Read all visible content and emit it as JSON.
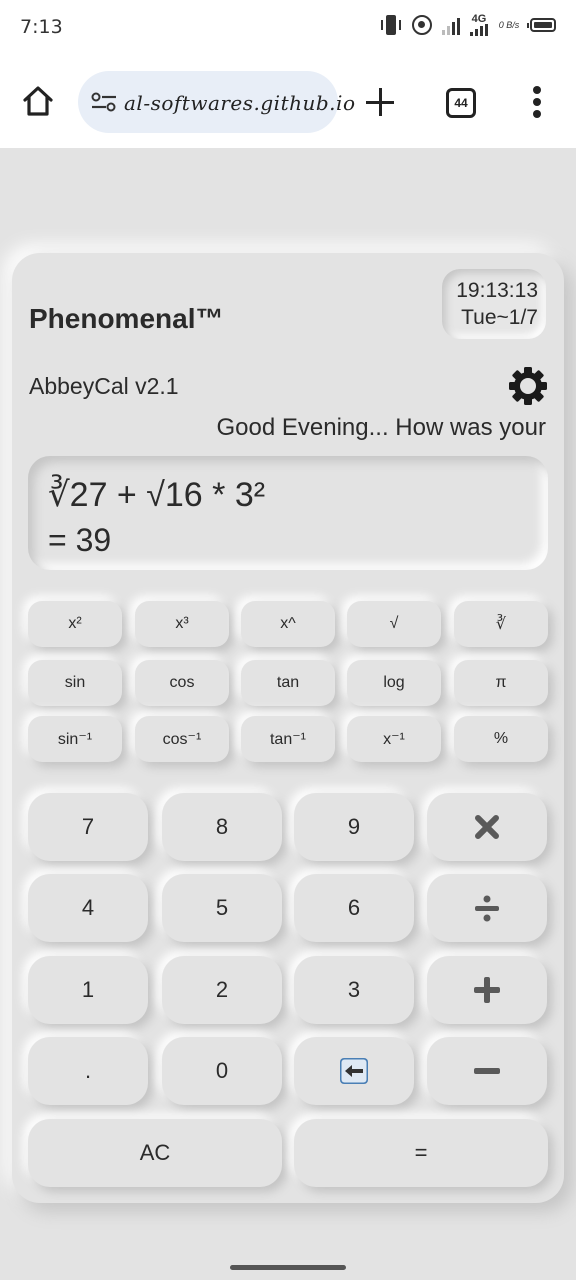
{
  "status_bar": {
    "time": "7:13",
    "network": "4G",
    "speed": "0 B/s"
  },
  "browser": {
    "url": "al-softwares.github.io",
    "tab_count": "44"
  },
  "calculator": {
    "brand": "Phenomenal™",
    "clock_time": "19:13:13",
    "clock_date": "Tue~1/7",
    "version": "AbbeyCal v2.1",
    "greeting": "Good Evening... How was your",
    "expression": "∛27 + √16 * 3²",
    "result": "= 39",
    "function_rows": [
      [
        "x²",
        "x³",
        "x^",
        "√",
        "∛"
      ],
      [
        "sin",
        "cos",
        "tan",
        "log",
        "π"
      ],
      [
        "sin⁻¹",
        "cos⁻¹",
        "tan⁻¹",
        "x⁻¹",
        "%"
      ]
    ],
    "number_rows": [
      [
        "7",
        "8",
        "9"
      ],
      [
        "4",
        "5",
        "6"
      ],
      [
        "1",
        "2",
        "3"
      ],
      [
        ".",
        "0"
      ]
    ],
    "clear_label": "AC",
    "equals_label": "=",
    "operator_icons": [
      "multiply-icon",
      "divide-icon",
      "plus-icon",
      "minus-icon"
    ],
    "backspace_icon": "backspace-arrow-icon"
  }
}
